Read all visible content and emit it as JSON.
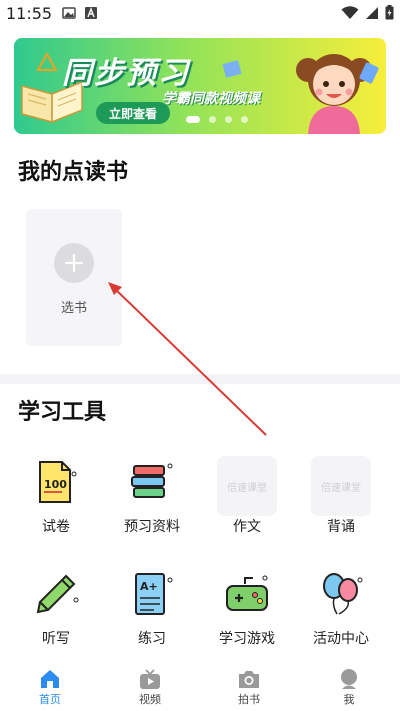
{
  "status_bar": {
    "time": "11:55"
  },
  "banner": {
    "title": "同步预习",
    "subtitle": "学霸同款视频课",
    "button": "立即查看"
  },
  "my_books": {
    "title": "我的点读书",
    "add_label": "选书"
  },
  "tools": {
    "title": "学习工具",
    "placeholder_text": "倍速课堂",
    "items": [
      {
        "label": "试卷",
        "icon": "exam-paper-icon"
      },
      {
        "label": "预习资料",
        "icon": "books-stack-icon"
      },
      {
        "label": "作文",
        "icon": "placeholder"
      },
      {
        "label": "背诵",
        "icon": "placeholder"
      },
      {
        "label": "听写",
        "icon": "pencil-icon"
      },
      {
        "label": "练习",
        "icon": "practice-sheet-icon"
      },
      {
        "label": "学习游戏",
        "icon": "gamepad-icon"
      },
      {
        "label": "活动中心",
        "icon": "balloons-icon"
      }
    ]
  },
  "tab_bar": {
    "active_color": "#2a8cf0",
    "items": [
      {
        "label": "首页",
        "icon": "home-icon"
      },
      {
        "label": "视频",
        "icon": "video-icon"
      },
      {
        "label": "拍书",
        "icon": "camera-icon"
      },
      {
        "label": "我",
        "icon": "profile-icon"
      }
    ]
  }
}
